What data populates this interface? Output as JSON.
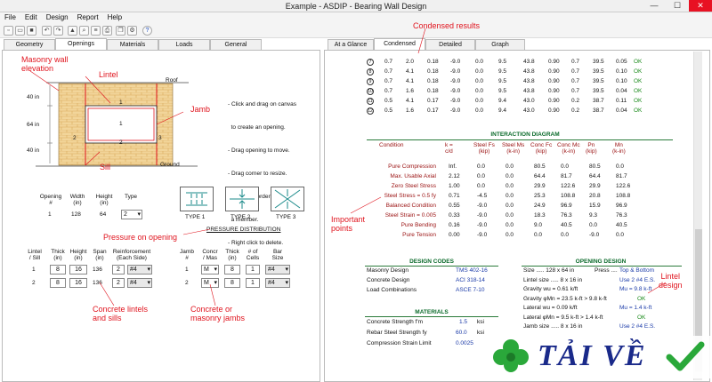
{
  "window": {
    "title": "Example - ASDIP - Bearing Wall Design",
    "controls": [
      "—",
      "☐",
      "✕"
    ]
  },
  "menu": [
    "File",
    "Edit",
    "Design",
    "Report",
    "Help"
  ],
  "left_tabs": [
    "Geometry",
    "Openings",
    "Materials",
    "Loads",
    "General"
  ],
  "right_tabs": [
    "At a Glance",
    "Condensed",
    "Detailed",
    "Graph"
  ],
  "annotations": {
    "masonry": "Masonry wall\nelevation",
    "lintel": "Lintel",
    "jamb": "Jamb",
    "sill": "Sill",
    "condensed": "Condensed results",
    "pressure": "Pressure on opening",
    "concrete_lintels": "Concrete lintels\nand sills",
    "concrete_jambs": "Concrete or\nmasonry jambs",
    "important": "Important\npoints",
    "lintel_design": "Lintel\ndesign"
  },
  "elevation": {
    "roof": "Roof",
    "ground": "Ground",
    "dim_top": "40 in",
    "dim_mid": "64 in",
    "dim_bot": "40 in",
    "n1": "1",
    "n2": "2",
    "n3": "3"
  },
  "instructions": [
    "- Click and drag on canvas",
    "  to create an opening.",
    "- Drag opening to move.",
    "- Drag corner to resize.",
    "- Click on border to create",
    "  a member.",
    "- Right click to delete."
  ],
  "opening_table": {
    "headers": [
      "Opening\n#",
      "Width\n(in)",
      "Height\n(in)",
      "Type"
    ],
    "row": [
      "1",
      "128",
      "64",
      "2"
    ]
  },
  "types": [
    "TYPE 1",
    "TYPE 2",
    "TYPE 3"
  ],
  "pressure_dist": "PRESSURE DISTRIBUTION",
  "lintel_table": {
    "headers": [
      "Lintel\n/ Sill",
      "Thick\n(in)",
      "Height\n(in)",
      "Span\n(in)",
      "Reinforcement\n(Each Side)"
    ],
    "rows": [
      [
        "1",
        "8",
        "16",
        "136",
        "2",
        "#4"
      ],
      [
        "2",
        "8",
        "16",
        "136",
        "2",
        "#4"
      ]
    ]
  },
  "jamb_table": {
    "headers": [
      "Jamb\n#",
      "Concr\n/ Mas",
      "Thick\n(in)",
      "# of\nCells",
      "Bar\nSize"
    ],
    "rows": [
      [
        "1",
        "M",
        "8",
        "1",
        "#4"
      ],
      [
        "2",
        "M",
        "8",
        "1",
        "#4"
      ]
    ]
  },
  "top_rows": [
    [
      "7",
      "0.7",
      "2.0",
      "0.18",
      "-9.0",
      "0.0",
      "9.5",
      "43.8",
      "0.90",
      "0.7",
      "39.5",
      "0.05",
      "OK"
    ],
    [
      "8",
      "0.7",
      "4.1",
      "0.18",
      "-9.0",
      "0.0",
      "9.5",
      "43.8",
      "0.90",
      "0.7",
      "39.5",
      "0.10",
      "OK"
    ],
    [
      "9",
      "0.7",
      "4.1",
      "0.18",
      "-9.0",
      "0.0",
      "9.5",
      "43.8",
      "0.90",
      "0.7",
      "39.5",
      "0.10",
      "OK"
    ],
    [
      "10",
      "0.7",
      "1.6",
      "0.18",
      "-9.0",
      "0.0",
      "9.5",
      "43.8",
      "0.90",
      "0.7",
      "39.5",
      "0.04",
      "OK"
    ],
    [
      "11",
      "0.5",
      "4.1",
      "0.17",
      "-9.0",
      "0.0",
      "9.4",
      "43.0",
      "0.90",
      "0.2",
      "38.7",
      "0.11",
      "OK"
    ],
    [
      "12",
      "0.5",
      "1.6",
      "0.17",
      "-9.0",
      "0.0",
      "9.4",
      "43.0",
      "0.90",
      "0.2",
      "38.7",
      "0.04",
      "OK"
    ]
  ],
  "interaction": {
    "title": "INTERACTION DIAGRAM",
    "headers": [
      "Condition",
      "k =\nc/d",
      "Steel Fs\n(kip)",
      "Steel Ms\n(k-in)",
      "Conc Fc\n(kip)",
      "Conc Mc\n(k-in)",
      "Pn\n(kip)",
      "Mn\n(k-in)"
    ],
    "rows": [
      [
        "Pure Compression",
        "Inf.",
        "0.0",
        "0.0",
        "80.5",
        "0.0",
        "80.5",
        "0.0"
      ],
      [
        "Max. Usable Axial",
        "2.12",
        "0.0",
        "0.0",
        "64.4",
        "81.7",
        "64.4",
        "81.7"
      ],
      [
        "Zero Steel Stress",
        "1.00",
        "0.0",
        "0.0",
        "29.9",
        "122.6",
        "29.9",
        "122.6"
      ],
      [
        "Steel Stress = 0.5 fy",
        "0.71",
        "-4.5",
        "0.0",
        "25.3",
        "108.8",
        "20.8",
        "108.8"
      ],
      [
        "Balanced Condition",
        "0.55",
        "-9.0",
        "0.0",
        "24.9",
        "96.9",
        "15.9",
        "96.9"
      ],
      [
        "Steel Strain = 0.005",
        "0.33",
        "-9.0",
        "0.0",
        "18.3",
        "76.3",
        "9.3",
        "76.3"
      ],
      [
        "Pure Bending",
        "0.16",
        "-9.0",
        "0.0",
        "9.0",
        "40.5",
        "0.0",
        "40.5"
      ],
      [
        "Pure Tension",
        "0.00",
        "-9.0",
        "0.0",
        "0.0",
        "0.0",
        "-9.0",
        "0.0"
      ]
    ]
  },
  "codes": {
    "title": "DESIGN CODES",
    "rows": [
      [
        "Masonry Design",
        "TMS 402-16"
      ],
      [
        "Concrete Design",
        "ACI 318-14"
      ],
      [
        "Load Combinations",
        "ASCE 7-10"
      ]
    ]
  },
  "materials": {
    "title": "MATERIALS",
    "rows": [
      [
        "Concrete Strength  f'm",
        "1.5",
        "ksi"
      ],
      [
        "Rebar Steel Strength  fy",
        "60.0",
        "ksi"
      ],
      [
        "Compression Strain Limit",
        "0.0025",
        ""
      ]
    ]
  },
  "opening_design": {
    "title": "OPENING DESIGN",
    "lines": [
      [
        "Size ..... 128 x 64 in",
        "Press ....",
        "Top & Bottom"
      ],
      [
        "Lintel size ..... 8 x 16 in",
        "",
        "Use 2 #4 E.S."
      ],
      [
        "Gravity wu = 0.61 k/ft",
        "",
        "Mu = 9.8 k-ft"
      ],
      [
        "Gravity φMn = 23.5 k-ft  >  9.8 k-ft",
        "",
        "OK"
      ],
      [
        "Lateral wu = 0.09 k/ft",
        "",
        "Mu = 1.4 k-ft"
      ],
      [
        "Lateral φMn = 9.5 k-ft  >  1.4 k-ft",
        "",
        "OK"
      ],
      [
        "Jamb size ..... 8 x 16 in",
        "",
        "Use 2 #4 E.S."
      ]
    ]
  },
  "logo": {
    "text": "TẢI VỀ"
  }
}
